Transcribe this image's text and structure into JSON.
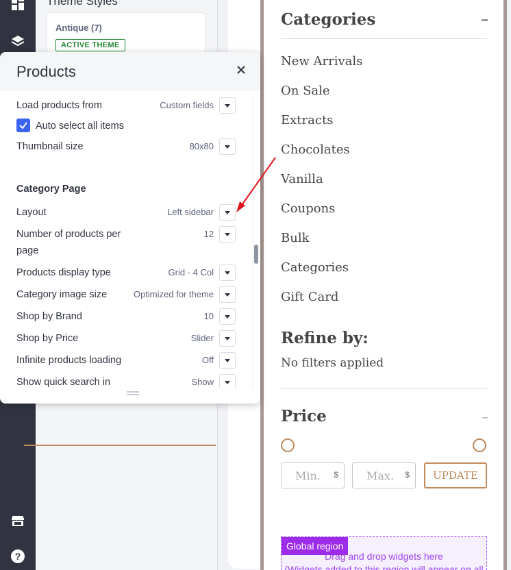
{
  "theme_styles": {
    "heading": "Theme Styles",
    "card_name": "Antique (7)",
    "badge": "ACTIVE THEME"
  },
  "panel": {
    "title": "Products",
    "rows_top": [
      {
        "label": "Load products from",
        "value": "Custom fields"
      },
      {
        "label": "Auto select all items",
        "checked": true
      },
      {
        "label": "Thumbnail size",
        "value": "80x80"
      }
    ],
    "section": "Category Page",
    "rows": [
      {
        "label": "Layout",
        "value": "Left sidebar"
      },
      {
        "label": "Number of products per page",
        "value": "12"
      },
      {
        "label": "Products display type",
        "value": "Grid - 4 Col"
      },
      {
        "label": "Category image size",
        "value": "Optimized for theme"
      },
      {
        "label": "Shop by Brand",
        "value": "10"
      },
      {
        "label": "Shop by Price",
        "value": "Slider"
      },
      {
        "label": "Infinite products loading",
        "value": "Off"
      },
      {
        "label": "Show quick search in",
        "value": "Show"
      }
    ]
  },
  "store": {
    "categories_title": "Categories",
    "categories_toggle": "–",
    "categories": [
      "New Arrivals",
      "On Sale",
      "Extracts",
      "Chocolates",
      "Vanilla",
      "Coupons",
      "Bulk",
      "Categories",
      "Gift Card"
    ],
    "refine_title": "Refine by:",
    "no_filters": "No filters applied",
    "price_title": "Price",
    "price_toggle": "–",
    "min_placeholder": "Min.",
    "max_placeholder": "Max.",
    "currency": "$",
    "update_label": "UPDATE"
  },
  "global_region": {
    "tag": "Global region",
    "text": "Drag and drop widgets here",
    "subtext": "(Widgets added to this region will appear on all"
  },
  "colors": {
    "rail": "#313440",
    "accent_blue": "#3c64f4",
    "brand_brown": "#c08a5c",
    "frame": "#a89893",
    "global_purple": "#9d2ce8",
    "annotation_red": "#e0141e"
  }
}
